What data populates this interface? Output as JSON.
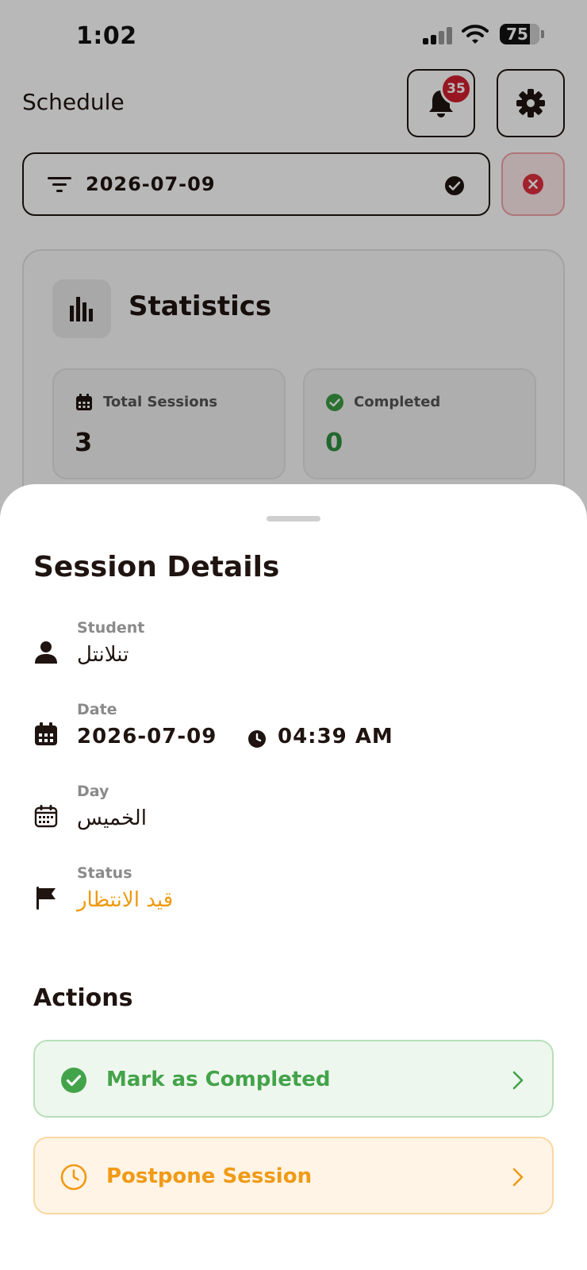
{
  "status_bar": {
    "time": "1:02",
    "battery": "75",
    "battery_level": 0.75
  },
  "header": {
    "title": "Schedule",
    "notification_count": "35",
    "icons": {
      "notifications": "bell-icon",
      "settings": "gear-icon"
    }
  },
  "filter": {
    "value": "2026-07-09",
    "icons": {
      "filter": "filter-icon",
      "applied": "check-circle-icon",
      "clear": "close-circle-icon"
    }
  },
  "statistics": {
    "title": "Statistics",
    "total": {
      "label": "Total Sessions",
      "value": "3"
    },
    "completed": {
      "label": "Completed",
      "value": "0"
    }
  },
  "sheet": {
    "title": "Session Details",
    "student": {
      "label": "Student",
      "value": "تنلانتل"
    },
    "date": {
      "label": "Date",
      "value": "2026-07-09",
      "time": "04:39 AM"
    },
    "day": {
      "label": "Day",
      "value": "الخميس"
    },
    "status": {
      "label": "Status",
      "value": "قيد الانتظار"
    },
    "actions_title": "Actions",
    "actions": {
      "complete": "Mark as Completed",
      "postpone": "Postpone Session"
    }
  },
  "colors": {
    "text": "#1f1410",
    "accent_green": "#43a34a",
    "accent_orange": "#f09a16",
    "badge_red": "#d21f2f"
  }
}
